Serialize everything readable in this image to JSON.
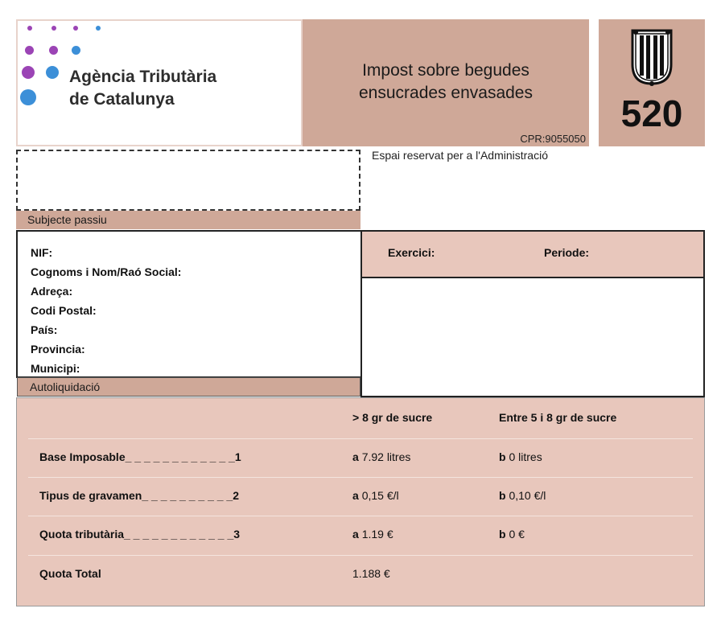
{
  "header": {
    "agency_line1": "Agència Tributària",
    "agency_line2": "de Catalunya",
    "title_line1": "Impost sobre begudes",
    "title_line2": "ensucrades envasades",
    "cpr": "CPR:9055050",
    "form_number": "520",
    "seal_icon": "catalonia-seal-icon",
    "logo_dot_colors": [
      "#9b44b5",
      "#3c8fd8"
    ]
  },
  "admin": {
    "reserved_label": "Espai reservat per a l'Administració"
  },
  "taxpayer": {
    "section_label": "Subjecte passiu",
    "fields": [
      "NIF:",
      "Cognoms i Nom/Raó Social:",
      "Adreça:",
      "Codi Postal:",
      "País:",
      "Provincia:",
      "Municipi:"
    ]
  },
  "period": {
    "exercici_label": "Exercici:",
    "periode_label": "Periode:"
  },
  "self_assessment": {
    "section_label": "Autoliquidació",
    "col_a_header": "> 8 gr de sucre",
    "col_b_header": "Entre 5 i 8 gr de sucre",
    "rows": [
      {
        "label": "Base Imposable_ _ _ _ _ _ _ _ _ _ _ _1",
        "a_key": "a",
        "a_value": "7.92 litres",
        "b_key": "b",
        "b_value": "0 litres"
      },
      {
        "label": "Tipus de gravamen_ _ _ _ _ _ _ _ _ _2",
        "a_key": "a",
        "a_value": "0,15 €/l",
        "b_key": "b",
        "b_value": "0,10 €/l"
      },
      {
        "label": "Quota tributària_ _ _ _ _ _ _ _ _ _ _ _3",
        "a_key": "a",
        "a_value": "1.19 €",
        "b_key": "b",
        "b_value": "0 €"
      }
    ],
    "total_label": "Quota Total",
    "total_value": "1.188 €"
  }
}
